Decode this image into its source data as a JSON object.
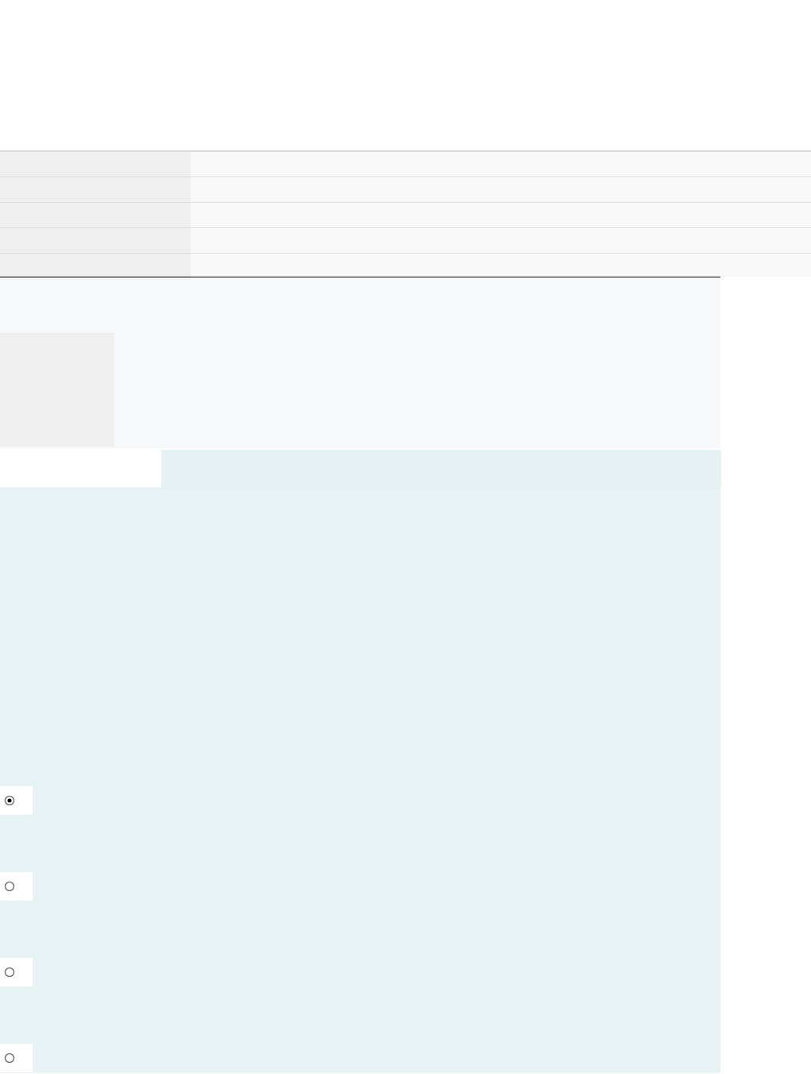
{
  "options": [
    {
      "selected": true
    },
    {
      "selected": false
    },
    {
      "selected": false
    },
    {
      "selected": false
    }
  ]
}
